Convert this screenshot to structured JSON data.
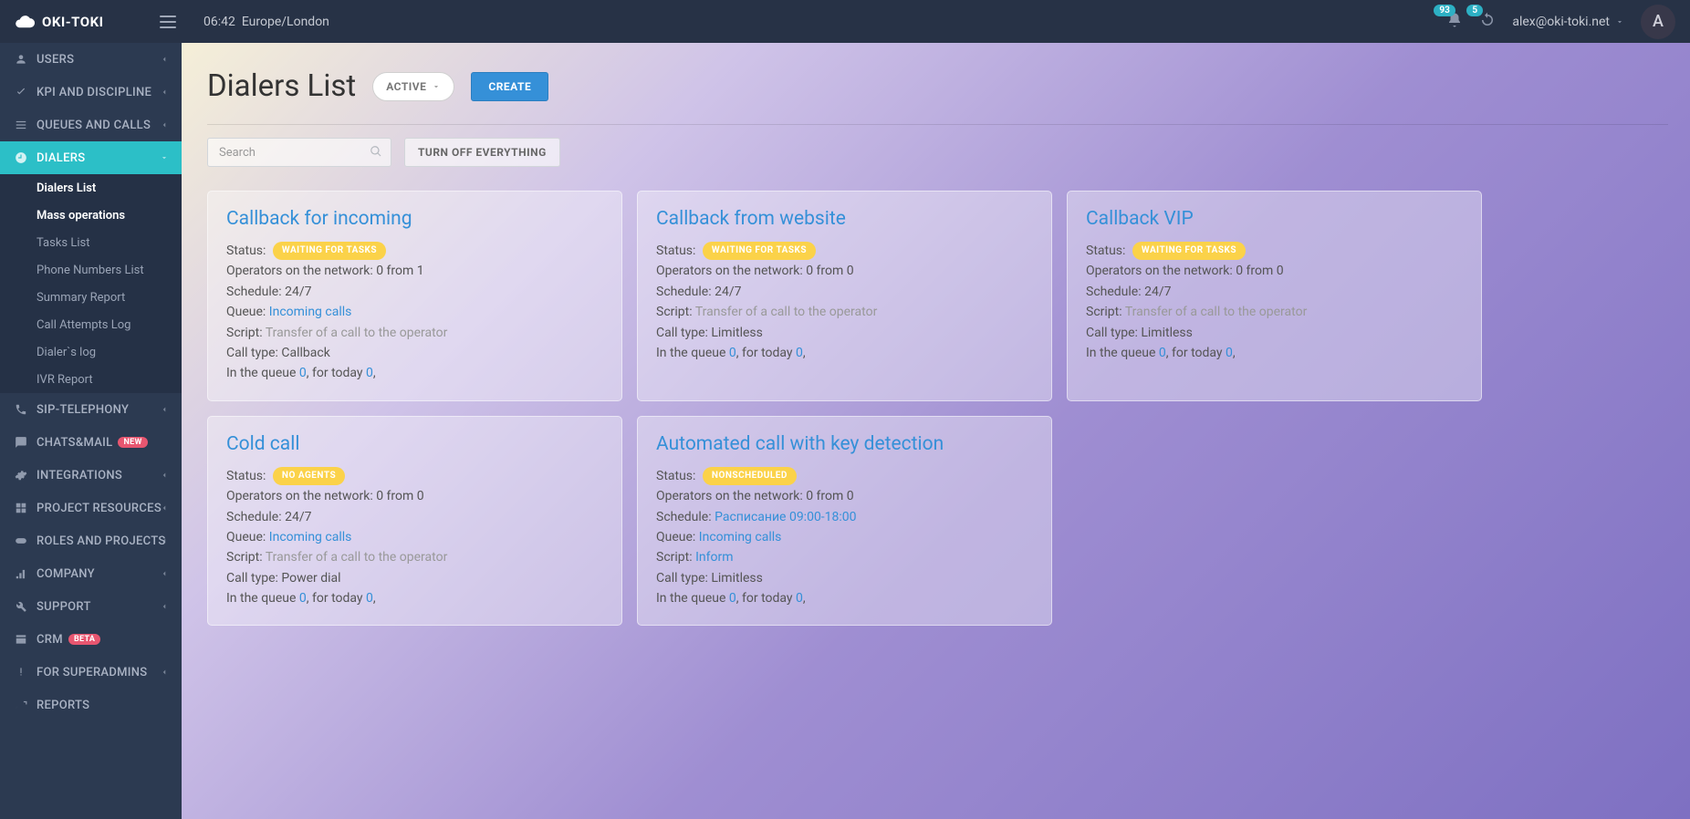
{
  "brand": "OKI-TOKI",
  "time": "06:42",
  "timezone": "Europe/London",
  "notifications": {
    "count1": "93",
    "count2": "5"
  },
  "user": {
    "email": "alex@oki-toki.net",
    "initial": "A"
  },
  "sidebar": {
    "users": "USERS",
    "kpi": "KPI AND DISCIPLINE",
    "queues": "QUEUES AND CALLS",
    "dialers": "DIALERS",
    "sip": "SIP-TELEPHONY",
    "chats": "CHATS&MAIL",
    "chats_badge": "NEW",
    "integrations": "INTEGRATIONS",
    "resources": "PROJECT RESOURCES",
    "roles": "ROLES AND PROJECTS",
    "company": "COMPANY",
    "support": "SUPPORT",
    "crm": "CRM",
    "crm_badge": "BETA",
    "superadmins": "FOR SUPERADMINS",
    "reports": "REPORTS",
    "sub": {
      "dialers_list": "Dialers List",
      "mass_ops": "Mass operations",
      "tasks_list": "Tasks List",
      "phone_list": "Phone Numbers List",
      "summary_report": "Summary Report",
      "call_attempts": "Call Attempts Log",
      "dialers_log": "Dialer`s log",
      "ivr_report": "IVR Report"
    }
  },
  "page": {
    "title": "Dialers List",
    "filter": "ACTIVE",
    "create": "CREATE",
    "search_placeholder": "Search",
    "turnoff": "TURN OFF EVERYTHING"
  },
  "labels": {
    "status": "Status:",
    "operators": "Operators on the network:",
    "schedule": "Schedule:",
    "queue": "Queue:",
    "script": "Script:",
    "call_type": "Call type:",
    "in_queue": "In the queue",
    "for_today": ", for today"
  },
  "cards": [
    {
      "title": "Callback for incoming",
      "status": "WAITING FOR TASKS",
      "operators": "0 from 1",
      "schedule": "24/7",
      "schedule_link": false,
      "queue": "Incoming calls",
      "script": "Transfer of a call to the operator",
      "script_muted": true,
      "call_type": "Callback",
      "in_queue": "0",
      "for_today": "0"
    },
    {
      "title": "Callback from website",
      "status": "WAITING FOR TASKS",
      "operators": "0 from 0",
      "schedule": "24/7",
      "schedule_link": false,
      "queue": "",
      "script": "Transfer of a call to the operator",
      "script_muted": true,
      "call_type": "Limitless",
      "in_queue": "0",
      "for_today": "0"
    },
    {
      "title": "Callback VIP",
      "status": "WAITING FOR TASKS",
      "operators": "0 from 0",
      "schedule": "24/7",
      "schedule_link": false,
      "queue": "",
      "script": "Transfer of a call to the operator",
      "script_muted": true,
      "call_type": "Limitless",
      "in_queue": "0",
      "for_today": "0"
    },
    {
      "title": "Cold call",
      "status": "NO AGENTS",
      "operators": "0 from 0",
      "schedule": "24/7",
      "schedule_link": false,
      "queue": "Incoming calls",
      "script": "Transfer of a call to the operator",
      "script_muted": true,
      "call_type": "Power dial",
      "in_queue": "0",
      "for_today": "0"
    },
    {
      "title": "Automated call with key detection",
      "status": "NONSCHEDULED",
      "operators": "0 from 0",
      "schedule": "Расписание 09:00-18:00",
      "schedule_link": true,
      "queue": "Incoming calls",
      "script": "Inform",
      "script_muted": false,
      "call_type": "Limitless",
      "in_queue": "0",
      "for_today": "0"
    }
  ]
}
